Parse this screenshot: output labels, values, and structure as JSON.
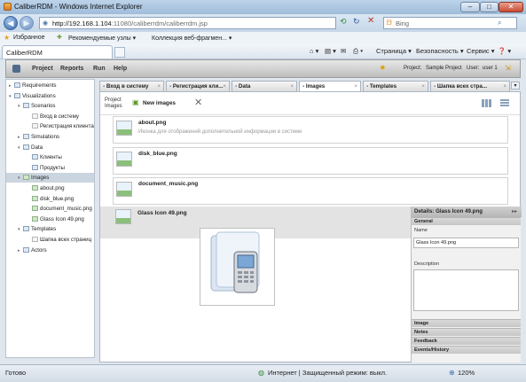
{
  "window": {
    "title": "CaliberRDM - Windows Internet Explorer"
  },
  "address": {
    "url_host": "http://192.168.1.104",
    "url_rest": ":11080/caliberrdm/caliberrdm.jsp",
    "search_placeholder": "Bing"
  },
  "favorites": {
    "label": "Избранное",
    "items": [
      "Рекомендуемые узлы ▾",
      "Коллекция веб-фрагмен... ▾"
    ]
  },
  "ie_tab": {
    "label": "CaliberRDM"
  },
  "commands": {
    "page": "Страница ▾",
    "security": "Безопасность ▾",
    "service": "Сервис ▾",
    "help": "❓ ▾"
  },
  "app_menu": {
    "items": [
      "Project",
      "Reports",
      "Run",
      "Help"
    ],
    "project_label": "Project:",
    "project_value": "Sample Project",
    "user_label": "User:",
    "user_value": "user 1"
  },
  "tree": [
    {
      "label": "Requirements",
      "level": 0,
      "toggle": "▸",
      "icon": "folder"
    },
    {
      "label": "Visualizations",
      "level": 0,
      "toggle": "▾",
      "icon": "folder"
    },
    {
      "label": "Scenarios",
      "level": 1,
      "toggle": "▾",
      "icon": "folder"
    },
    {
      "label": "Вход в систему",
      "level": 2,
      "toggle": "",
      "icon": "doc"
    },
    {
      "label": "Регистрация клиента",
      "level": 2,
      "toggle": "",
      "icon": "doc"
    },
    {
      "label": "Simulations",
      "level": 1,
      "toggle": "▸",
      "icon": "folder"
    },
    {
      "label": "Data",
      "level": 1,
      "toggle": "▾",
      "icon": "folder"
    },
    {
      "label": "Клиенты",
      "level": 2,
      "toggle": "",
      "icon": "folder"
    },
    {
      "label": "Продукты",
      "level": 2,
      "toggle": "",
      "icon": "folder"
    },
    {
      "label": "Images",
      "level": 1,
      "toggle": "▾",
      "icon": "img",
      "selected": true
    },
    {
      "label": "about.png",
      "level": 2,
      "toggle": "",
      "icon": "img"
    },
    {
      "label": "disk_blue.png",
      "level": 2,
      "toggle": "",
      "icon": "img"
    },
    {
      "label": "document_music.png",
      "level": 2,
      "toggle": "",
      "icon": "img"
    },
    {
      "label": "Glass Icon 49.png",
      "level": 2,
      "toggle": "",
      "icon": "img"
    },
    {
      "label": "Templates",
      "level": 1,
      "toggle": "▾",
      "icon": "folder"
    },
    {
      "label": "Шапка всех страниц",
      "level": 2,
      "toggle": "",
      "icon": "doc"
    },
    {
      "label": "Actors",
      "level": 1,
      "toggle": "▸",
      "icon": "folder"
    }
  ],
  "tabs": [
    {
      "label": "Вход в систему",
      "active": false
    },
    {
      "label": "Регистрация кли...",
      "active": false
    },
    {
      "label": "Data",
      "active": false
    },
    {
      "label": "Images",
      "active": true
    },
    {
      "label": "Templates",
      "active": false
    },
    {
      "label": "Шапка всех стра...",
      "active": false
    }
  ],
  "toolbar": {
    "project_images": "Project\nImages",
    "new_images": "New images"
  },
  "images": [
    {
      "name": "about.png",
      "desc": "Иконка для отображений дополнительной информации в системе"
    },
    {
      "name": "disk_blue.png",
      "desc": ""
    },
    {
      "name": "document_music.png",
      "desc": ""
    },
    {
      "name": "Glass Icon 49.png",
      "desc": ""
    }
  ],
  "details": {
    "title": "Details: Glass Icon 49.png",
    "general": "General",
    "name_label": "Name",
    "name_value": "Glass Icon 49.png",
    "description_label": "Description",
    "sections": [
      "Image",
      "Notes",
      "Feedback",
      "Events/History"
    ]
  },
  "status": {
    "left": "Готово",
    "zone": "Интернет | Защищенный режим: выкл.",
    "zoom": "120%"
  }
}
